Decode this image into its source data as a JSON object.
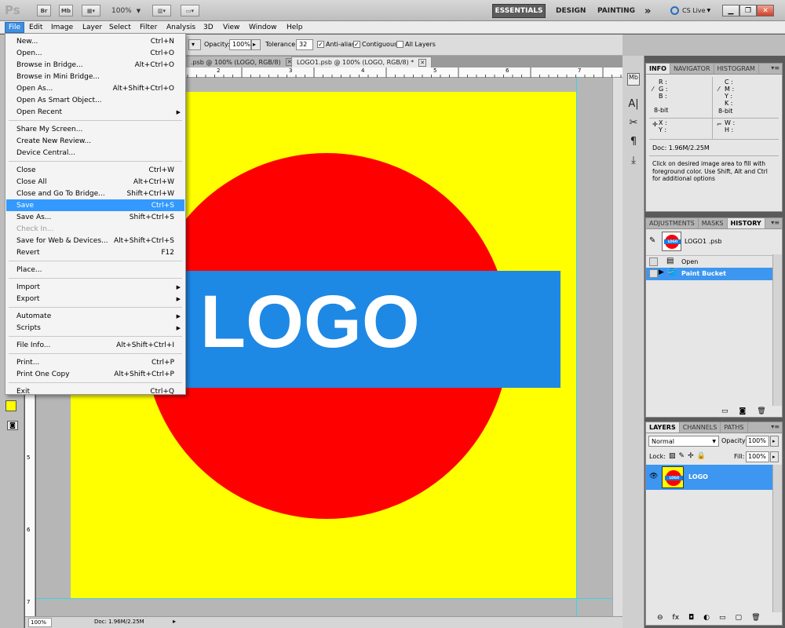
{
  "app": {
    "logo": "Ps",
    "bridge_btn": "Br",
    "minibridge_btn": "Mb",
    "zoom": "100%",
    "workspaces": [
      "ESSENTIALS",
      "DESIGN",
      "PAINTING"
    ],
    "overflow": "»",
    "cslive": "CS Live"
  },
  "menubar": [
    "File",
    "Edit",
    "Image",
    "Layer",
    "Select",
    "Filter",
    "Analysis",
    "3D",
    "View",
    "Window",
    "Help"
  ],
  "options": {
    "opacity_label": "Opacity:",
    "opacity_value": "100%",
    "tolerance_label": "Tolerance:",
    "tolerance_value": "32",
    "antialias_label": "Anti-alias",
    "contiguous_label": "Contiguous",
    "alllayers_label": "All Layers"
  },
  "doc_tabs": [
    ".psb @ 100% (LOGO, RGB/8)",
    "LOGO1.psb @ 100% (LOGO, RGB/8) *"
  ],
  "canvas": {
    "logo_text": "LOGO",
    "bg_color": "#ffff00",
    "circle_color": "#ff0000",
    "band_color": "#1e88e5",
    "text_color": "#ffffff"
  },
  "ruler_top_labels": [
    "2",
    "3",
    "4",
    "5",
    "6",
    "7"
  ],
  "ruler_left_labels": [
    "5",
    "6",
    "7"
  ],
  "status": {
    "zoom": "100%",
    "doc": "Doc: 1.96M/2.25M"
  },
  "file_menu": [
    {
      "label": "New...",
      "shortcut": "Ctrl+N"
    },
    {
      "label": "Open...",
      "shortcut": "Ctrl+O"
    },
    {
      "label": "Browse in Bridge...",
      "shortcut": "Alt+Ctrl+O"
    },
    {
      "label": "Browse in Mini Bridge...",
      "shortcut": ""
    },
    {
      "label": "Open As...",
      "shortcut": "Alt+Shift+Ctrl+O"
    },
    {
      "label": "Open As Smart Object...",
      "shortcut": ""
    },
    {
      "label": "Open Recent",
      "shortcut": "",
      "submenu": true
    },
    {
      "label": "Share My Screen...",
      "shortcut": ""
    },
    {
      "label": "Create New Review...",
      "shortcut": ""
    },
    {
      "label": "Device Central...",
      "shortcut": ""
    },
    {
      "label": "Close",
      "shortcut": "Ctrl+W"
    },
    {
      "label": "Close All",
      "shortcut": "Alt+Ctrl+W"
    },
    {
      "label": "Close and Go To Bridge...",
      "shortcut": "Shift+Ctrl+W"
    },
    {
      "label": "Save",
      "shortcut": "Ctrl+S",
      "highlighted": true
    },
    {
      "label": "Save As...",
      "shortcut": "Shift+Ctrl+S"
    },
    {
      "label": "Check In...",
      "shortcut": "",
      "disabled": true
    },
    {
      "label": "Save for Web & Devices...",
      "shortcut": "Alt+Shift+Ctrl+S"
    },
    {
      "label": "Revert",
      "shortcut": "F12"
    },
    {
      "label": "Place...",
      "shortcut": ""
    },
    {
      "label": "Import",
      "shortcut": "",
      "submenu": true
    },
    {
      "label": "Export",
      "shortcut": "",
      "submenu": true
    },
    {
      "label": "Automate",
      "shortcut": "",
      "submenu": true
    },
    {
      "label": "Scripts",
      "shortcut": "",
      "submenu": true
    },
    {
      "label": "File Info...",
      "shortcut": "Alt+Shift+Ctrl+I"
    },
    {
      "label": "Print...",
      "shortcut": "Ctrl+P"
    },
    {
      "label": "Print One Copy",
      "shortcut": "Alt+Shift+Ctrl+P"
    },
    {
      "label": "Exit",
      "shortcut": "Ctrl+Q"
    }
  ],
  "info_panel": {
    "tabs": [
      "INFO",
      "NAVIGATOR",
      "HISTOGRAM"
    ],
    "r": "R :",
    "g": "G :",
    "b": "B :",
    "c": "C :",
    "m": "M :",
    "y": "Y :",
    "k": "K :",
    "bit_left": "8-bit",
    "bit_right": "8-bit",
    "x": "X :",
    "yy": "Y :",
    "w": "W :",
    "h": "H :",
    "doc": "Doc: 1.96M/2.25M",
    "hint": "Click on desired image area to fill with foreground color.  Use Shift, Alt and Ctrl for additional options"
  },
  "history_panel": {
    "tabs": [
      "ADJUSTMENTS",
      "MASKS",
      "HISTORY"
    ],
    "snapshot": "LOGO1 .psb",
    "steps": [
      "Open",
      "Paint Bucket"
    ],
    "thumb_label": "LOGO"
  },
  "layers_panel": {
    "tabs": [
      "LAYERS",
      "CHANNELS",
      "PATHS"
    ],
    "blend_mode": "Normal",
    "opacity_label": "Opacity:",
    "opacity_value": "100%",
    "lock_label": "Lock:",
    "fill_label": "Fill:",
    "fill_value": "100%",
    "layer_name": "LOGO",
    "thumb_label": "LOGO"
  }
}
